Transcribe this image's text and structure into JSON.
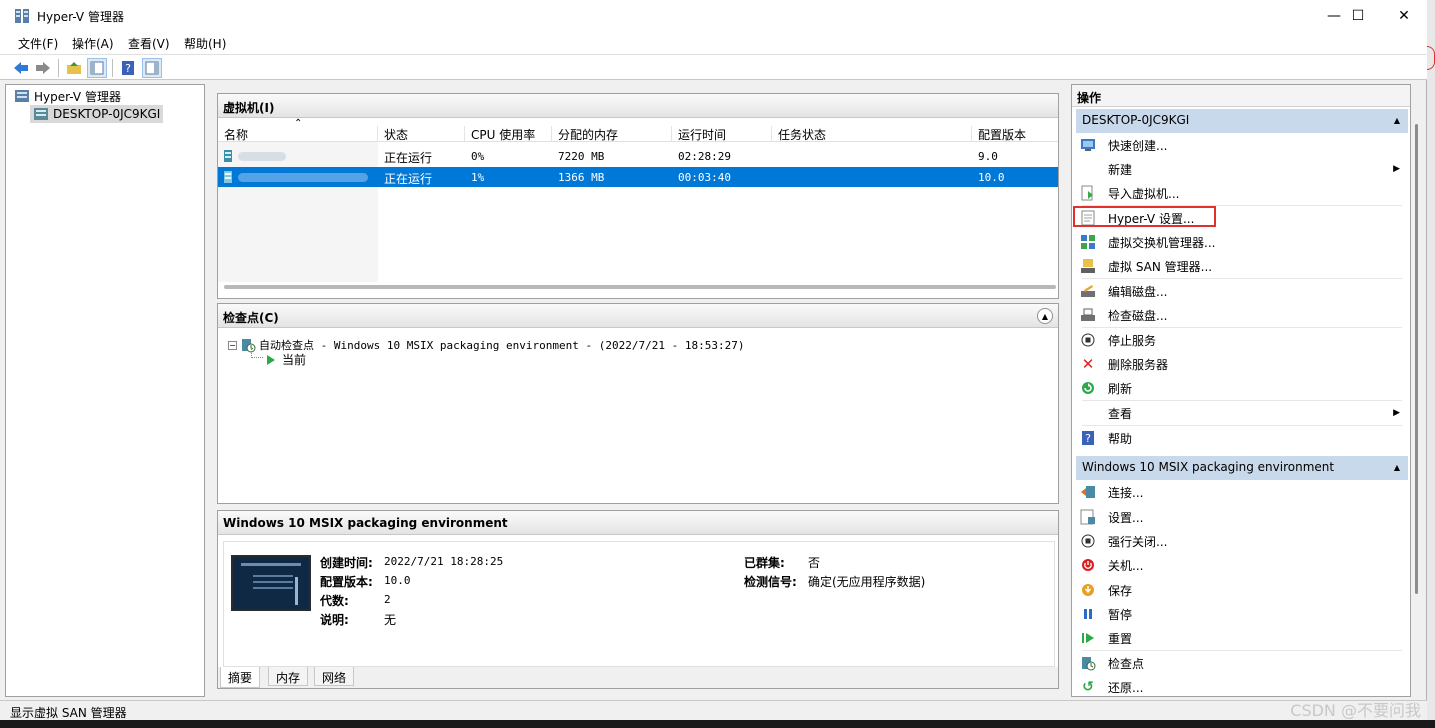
{
  "window": {
    "title": "Hyper-V 管理器",
    "minimize": "—",
    "maximize": "☐",
    "close": "✕"
  },
  "menu": [
    "文件(F)",
    "操作(A)",
    "查看(V)",
    "帮助(H)"
  ],
  "tree": {
    "root": "Hyper-V 管理器",
    "server": "DESKTOP-0JC9KGI"
  },
  "vm_panel": {
    "title": "虚拟机(I)",
    "columns": [
      "名称",
      "状态",
      "CPU 使用率",
      "分配的内存",
      "运行时间",
      "任务状态",
      "配置版本"
    ],
    "rows": [
      {
        "status": "正在运行",
        "cpu": "0%",
        "memory": "7220 MB",
        "uptime": "02:28:29",
        "task": "",
        "version": "9.0"
      },
      {
        "status": "正在运行",
        "cpu": "1%",
        "memory": "1366 MB",
        "uptime": "00:03:40",
        "task": "",
        "version": "10.0"
      }
    ]
  },
  "checkpoint_panel": {
    "title": "检查点(C)",
    "checkpoint": "自动检查点 - Windows 10 MSIX packaging environment - (2022/7/21 - 18:53:27)",
    "current": "当前"
  },
  "detail_panel": {
    "title": "Windows 10 MSIX packaging environment",
    "fields_left": [
      {
        "label": "创建时间:",
        "value": "2022/7/21 18:28:25"
      },
      {
        "label": "配置版本:",
        "value": "10.0"
      },
      {
        "label": "代数:",
        "value": "2"
      },
      {
        "label": "说明:",
        "value": "无"
      }
    ],
    "fields_right": [
      {
        "label": "已群集:",
        "value": "否"
      },
      {
        "label": "检测信号:",
        "value": "确定(无应用程序数据)"
      }
    ],
    "tabs": [
      "摘要",
      "内存",
      "网络"
    ]
  },
  "actions": {
    "header": "操作",
    "server_section": "DESKTOP-0JC9KGI",
    "server_items": [
      "快速创建...",
      "新建",
      "导入虚拟机...",
      "Hyper-V 设置...",
      "虚拟交换机管理器...",
      "虚拟 SAN 管理器...",
      "编辑磁盘...",
      "检查磁盘...",
      "停止服务",
      "删除服务器",
      "刷新",
      "查看",
      "帮助"
    ],
    "vm_section": "Windows 10 MSIX packaging environment",
    "vm_items": [
      "连接...",
      "设置...",
      "强行关闭...",
      "关机...",
      "保存",
      "暂停",
      "重置",
      "检查点",
      "还原..."
    ],
    "colors": {
      "section_bg": "#c9d9ec",
      "highlight": "#e03030",
      "selection": "#0078d7"
    }
  },
  "status": "显示虚拟 SAN 管理器",
  "watermark": "CSDN @不要问我"
}
